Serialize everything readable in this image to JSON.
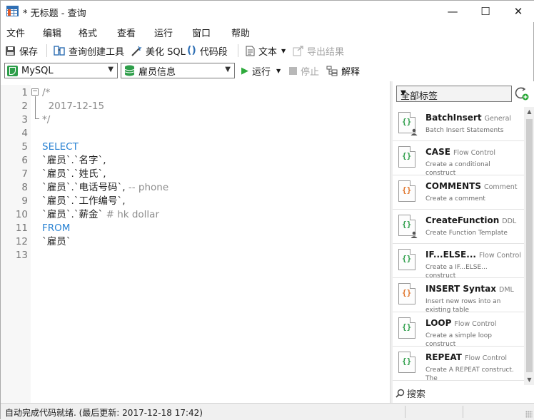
{
  "window": {
    "title": "* 无标题 - 查询",
    "minimize_glyph": "—",
    "maximize_glyph": "☐",
    "close_glyph": "✕"
  },
  "menu": [
    "文件",
    "编辑",
    "格式",
    "查看",
    "运行",
    "窗口",
    "帮助"
  ],
  "toolbar": {
    "save": "保存",
    "query_builder": "查询创建工具",
    "beautify_sql": "美化 SQL",
    "code_snippet": "代码段",
    "text": "文本",
    "export_result": "导出结果"
  },
  "connection_bar": {
    "connection": "MySQL",
    "database": "雇员信息",
    "run": "运行",
    "stop": "停止",
    "explain": "解释"
  },
  "editor": {
    "lines": [
      {
        "n": "1",
        "segments": [
          {
            "t": "/*",
            "c": "comment"
          }
        ]
      },
      {
        "n": "2",
        "segments": [
          {
            "t": "  2017-12-15",
            "c": "comment"
          }
        ]
      },
      {
        "n": "3",
        "segments": [
          {
            "t": "*/",
            "c": "comment"
          }
        ]
      },
      {
        "n": "4",
        "segments": []
      },
      {
        "n": "5",
        "segments": [
          {
            "t": "SELECT",
            "c": "keyword"
          }
        ]
      },
      {
        "n": "6",
        "segments": [
          {
            "t": "`雇员`.`名字`,",
            "c": "ident"
          }
        ]
      },
      {
        "n": "7",
        "segments": [
          {
            "t": "`雇员`.`姓氏`,",
            "c": "ident"
          }
        ]
      },
      {
        "n": "8",
        "segments": [
          {
            "t": "`雇员`.`电话号码`,",
            "c": "ident"
          },
          {
            "t": " -- phone",
            "c": "comment"
          }
        ]
      },
      {
        "n": "9",
        "segments": [
          {
            "t": "`雇员`.`工作编号`,",
            "c": "ident"
          }
        ]
      },
      {
        "n": "10",
        "segments": [
          {
            "t": "`雇员`.`薪金`",
            "c": "ident"
          },
          {
            "t": " # hk dollar",
            "c": "comment"
          }
        ]
      },
      {
        "n": "11",
        "segments": [
          {
            "t": "FROM",
            "c": "keyword"
          }
        ]
      },
      {
        "n": "12",
        "segments": [
          {
            "t": "`雇员`",
            "c": "ident"
          }
        ]
      },
      {
        "n": "13",
        "segments": []
      }
    ],
    "colors": {
      "keyword": "#2a83d3",
      "comment": "#8c8c8c",
      "ident": "#1e1e1e"
    }
  },
  "snippets_panel": {
    "tag_filter": "全部标签",
    "search_label": "搜索",
    "items": [
      {
        "name": "BatchInsert",
        "tag": "General",
        "desc": "Batch Insert Statements",
        "icon": "brace-user-icon"
      },
      {
        "name": "CASE",
        "tag": "Flow Control",
        "desc": "Create a conditional construct",
        "icon": "brace-icon"
      },
      {
        "name": "COMMENTS",
        "tag": "Comment",
        "desc": "Create a comment",
        "icon": "brace-orange-icon"
      },
      {
        "name": "CreateFunction",
        "tag": "DDL",
        "desc": "Create Function Template",
        "icon": "brace-user-icon"
      },
      {
        "name": "IF...ELSE...",
        "tag": "Flow Control",
        "desc": "Create a IF...ELSE... construct",
        "icon": "brace-icon"
      },
      {
        "name": "INSERT Syntax",
        "tag": "DML",
        "desc": "Insert new rows into an existing table",
        "icon": "brace-orange-icon"
      },
      {
        "name": "LOOP",
        "tag": "Flow Control",
        "desc": "Create a simple loop construct",
        "icon": "brace-icon"
      },
      {
        "name": "REPEAT",
        "tag": "Flow Control",
        "desc": "Create A REPEAT construct. The",
        "icon": "brace-icon"
      }
    ]
  },
  "status": {
    "text": "自动完成代码就绪. (最后更新: 2017-12-18 17:42)"
  }
}
